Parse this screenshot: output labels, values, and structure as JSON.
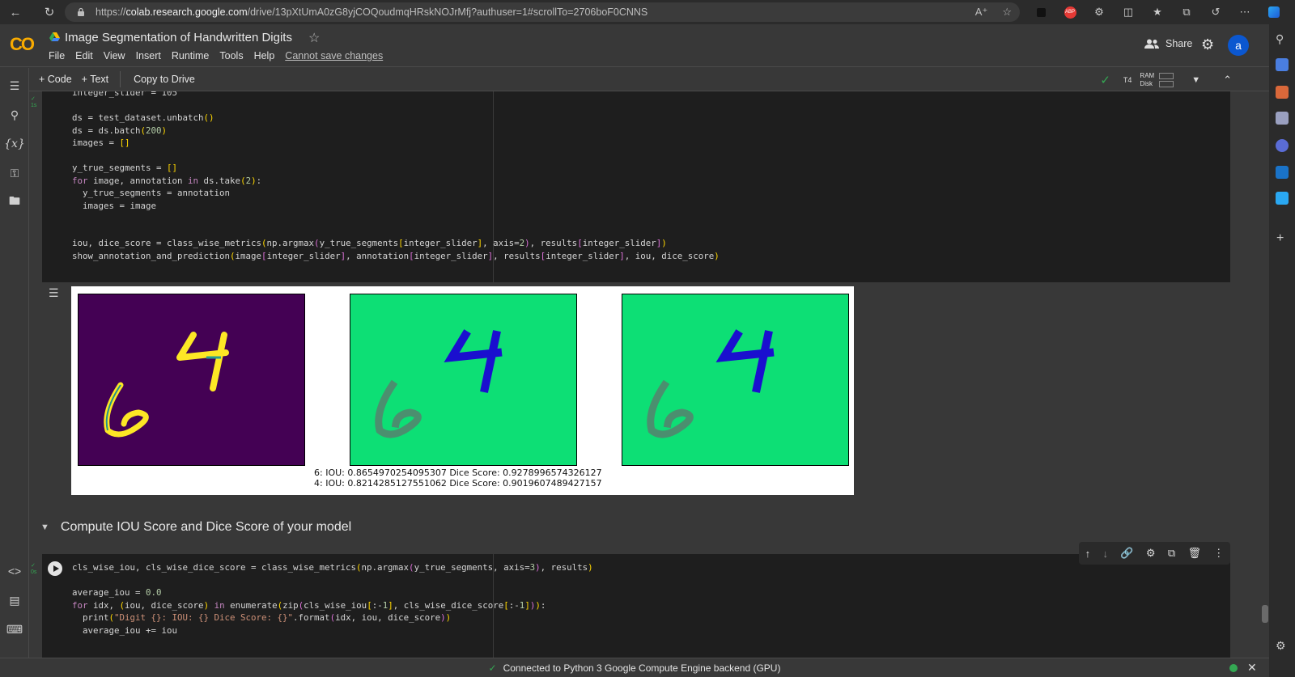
{
  "browser": {
    "url_prefix": "https://",
    "url_domain": "colab.research.google.com",
    "url_rest": "/drive/13pXtUmA0zG8yjCOQoudmqHRskNOJrMfj?authuser=1#scrollTo=2706boF0CNNS"
  },
  "header": {
    "logo": "CO",
    "title": "Image Segmentation of Handwritten Digits",
    "menu": [
      "File",
      "Edit",
      "View",
      "Insert",
      "Runtime",
      "Tools",
      "Help"
    ],
    "warning": "Cannot save changes",
    "share_label": "Share",
    "avatar_letter": "a"
  },
  "toolbar": {
    "add_code": "+ Code",
    "add_text": "+ Text",
    "copy_to_drive": "Copy to Drive",
    "runtime_type": "T4",
    "ram_label": "RAM",
    "disk_label": "Disk"
  },
  "cell1": {
    "exec_time": "1s",
    "lines": [
      "integer_slider = 105",
      "",
      "ds = test_dataset.unbatch()",
      "ds = ds.batch(200)",
      "images = []",
      "",
      "y_true_segments = []",
      "for image, annotation in ds.take(2):",
      "  y_true_segments = annotation",
      "  images = image",
      "",
      "",
      "iou, dice_score = class_wise_metrics(np.argmax(y_true_segments[integer_slider], axis=2), results[integer_slider])",
      "show_annotation_and_prediction(image[integer_slider], annotation[integer_slider], results[integer_slider], iou, dice_score)"
    ]
  },
  "output": {
    "metric_line_1": "6: IOU: 0.8654970254095307 Dice Score: 0.9278996574326127",
    "metric_line_2": "4: IOU: 0.8214285127551062 Dice Score: 0.9019607489427157",
    "colors": {
      "viridis_bg": "#440154",
      "viridis_digit": "#fde725",
      "mask_bg": "#0ddf75",
      "mask_digit4": "#1a0fcf",
      "mask_digit6": "#4b8f6f"
    }
  },
  "section": {
    "heading": "Compute IOU Score and Dice Score of your model"
  },
  "cell2": {
    "exec_time": "0s",
    "lines": [
      "cls_wise_iou, cls_wise_dice_score = class_wise_metrics(np.argmax(y_true_segments, axis=3), results)",
      "",
      "average_iou = 0.0",
      "for idx, (iou, dice_score) in enumerate(zip(cls_wise_iou[:-1], cls_wise_dice_score[:-1])):",
      "  print(\"Digit {}: IOU: {} Dice Score: {}\".format(idx, iou, dice_score))",
      "  average_iou += iou"
    ]
  },
  "status": {
    "text": "Connected to Python 3 Google Compute Engine backend (GPU)"
  }
}
